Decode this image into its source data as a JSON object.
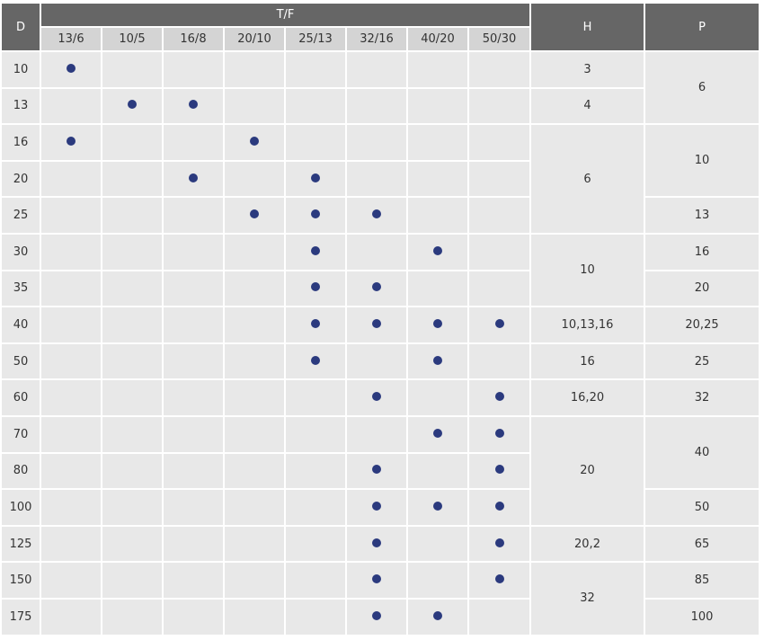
{
  "headers": {
    "d": "D",
    "tf": "T/F",
    "h": "H",
    "p": "P",
    "tf_sub": [
      "13/6",
      "10/5",
      "16/8",
      "20/10",
      "25/13",
      "32/16",
      "40/20",
      "50/30"
    ]
  },
  "dot_color": "#2b3a7e",
  "header_color": "#666666",
  "subheader_color": "#d4d4d4",
  "cell_color": "#e8e8e8",
  "rows": [
    {
      "d": "10",
      "marks": [
        1,
        0,
        0,
        0,
        0,
        0,
        0,
        0
      ]
    },
    {
      "d": "13",
      "marks": [
        0,
        1,
        1,
        0,
        0,
        0,
        0,
        0
      ]
    },
    {
      "d": "16",
      "marks": [
        1,
        0,
        0,
        1,
        0,
        0,
        0,
        0
      ]
    },
    {
      "d": "20",
      "marks": [
        0,
        0,
        1,
        0,
        1,
        0,
        0,
        0
      ]
    },
    {
      "d": "25",
      "marks": [
        0,
        0,
        0,
        1,
        1,
        1,
        0,
        0
      ]
    },
    {
      "d": "30",
      "marks": [
        0,
        0,
        0,
        0,
        1,
        0,
        1,
        0
      ]
    },
    {
      "d": "35",
      "marks": [
        0,
        0,
        0,
        0,
        1,
        1,
        0,
        0
      ]
    },
    {
      "d": "40",
      "marks": [
        0,
        0,
        0,
        0,
        1,
        1,
        1,
        1
      ]
    },
    {
      "d": "50",
      "marks": [
        0,
        0,
        0,
        0,
        1,
        0,
        1,
        0
      ]
    },
    {
      "d": "60",
      "marks": [
        0,
        0,
        0,
        0,
        0,
        1,
        0,
        1
      ]
    },
    {
      "d": "70",
      "marks": [
        0,
        0,
        0,
        0,
        0,
        0,
        1,
        1
      ]
    },
    {
      "d": "80",
      "marks": [
        0,
        0,
        0,
        0,
        0,
        1,
        0,
        1
      ]
    },
    {
      "d": "100",
      "marks": [
        0,
        0,
        0,
        0,
        0,
        1,
        1,
        1
      ]
    },
    {
      "d": "125",
      "marks": [
        0,
        0,
        0,
        0,
        0,
        1,
        0,
        1
      ]
    },
    {
      "d": "150",
      "marks": [
        0,
        0,
        0,
        0,
        0,
        1,
        0,
        1
      ]
    },
    {
      "d": "175",
      "marks": [
        0,
        0,
        0,
        0,
        0,
        1,
        1,
        0
      ]
    }
  ],
  "h_cells": [
    {
      "start": 0,
      "span": 1,
      "value": "3"
    },
    {
      "start": 1,
      "span": 1,
      "value": "4"
    },
    {
      "start": 2,
      "span": 3,
      "value": "6"
    },
    {
      "start": 5,
      "span": 2,
      "value": "10"
    },
    {
      "start": 7,
      "span": 1,
      "value": "10,13,16"
    },
    {
      "start": 8,
      "span": 1,
      "value": "16"
    },
    {
      "start": 9,
      "span": 1,
      "value": "16,20"
    },
    {
      "start": 10,
      "span": 3,
      "value": "20"
    },
    {
      "start": 13,
      "span": 1,
      "value": "20,2"
    },
    {
      "start": 14,
      "span": 2,
      "value": "32"
    }
  ],
  "p_cells": [
    {
      "start": 0,
      "span": 2,
      "value": "6"
    },
    {
      "start": 2,
      "span": 2,
      "value": "10"
    },
    {
      "start": 4,
      "span": 1,
      "value": "13"
    },
    {
      "start": 5,
      "span": 1,
      "value": "16"
    },
    {
      "start": 6,
      "span": 1,
      "value": "20"
    },
    {
      "start": 7,
      "span": 1,
      "value": "20,25"
    },
    {
      "start": 8,
      "span": 1,
      "value": "25"
    },
    {
      "start": 9,
      "span": 1,
      "value": "32"
    },
    {
      "start": 10,
      "span": 2,
      "value": "40"
    },
    {
      "start": 12,
      "span": 1,
      "value": "50"
    },
    {
      "start": 13,
      "span": 1,
      "value": "65"
    },
    {
      "start": 14,
      "span": 1,
      "value": "85"
    },
    {
      "start": 15,
      "span": 1,
      "value": "100"
    }
  ]
}
